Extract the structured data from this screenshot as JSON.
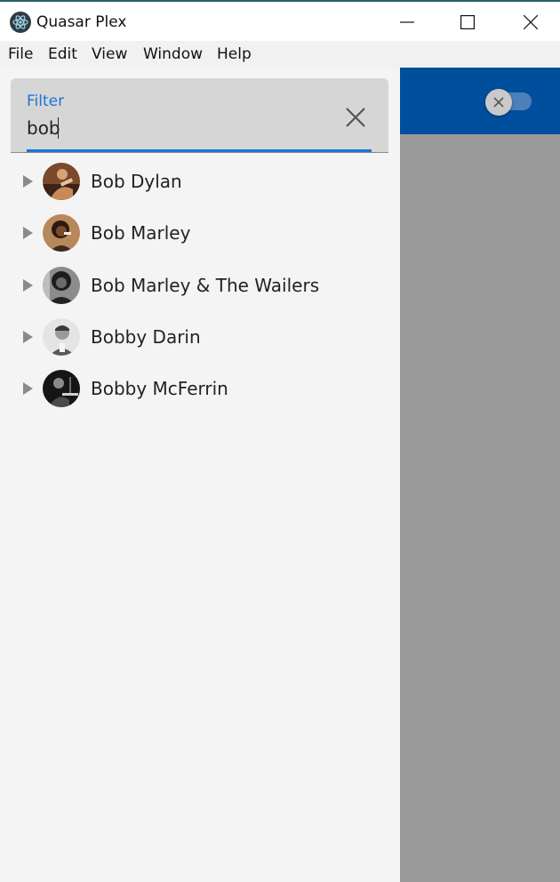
{
  "window": {
    "title": "Quasar Plex"
  },
  "menu": {
    "items": [
      "File",
      "Edit",
      "View",
      "Window",
      "Help"
    ]
  },
  "filter": {
    "label": "Filter",
    "value": "bob"
  },
  "artists": [
    {
      "name": "Bob Dylan"
    },
    {
      "name": "Bob Marley"
    },
    {
      "name": "Bob Marley & The Wailers"
    },
    {
      "name": "Bobby Darin"
    },
    {
      "name": "Bobby McFerrin"
    }
  ],
  "colors": {
    "accent": "#1976d2",
    "header": "#004f9c",
    "panel": "#9a9a9a",
    "drawer": "#f4f4f4"
  }
}
